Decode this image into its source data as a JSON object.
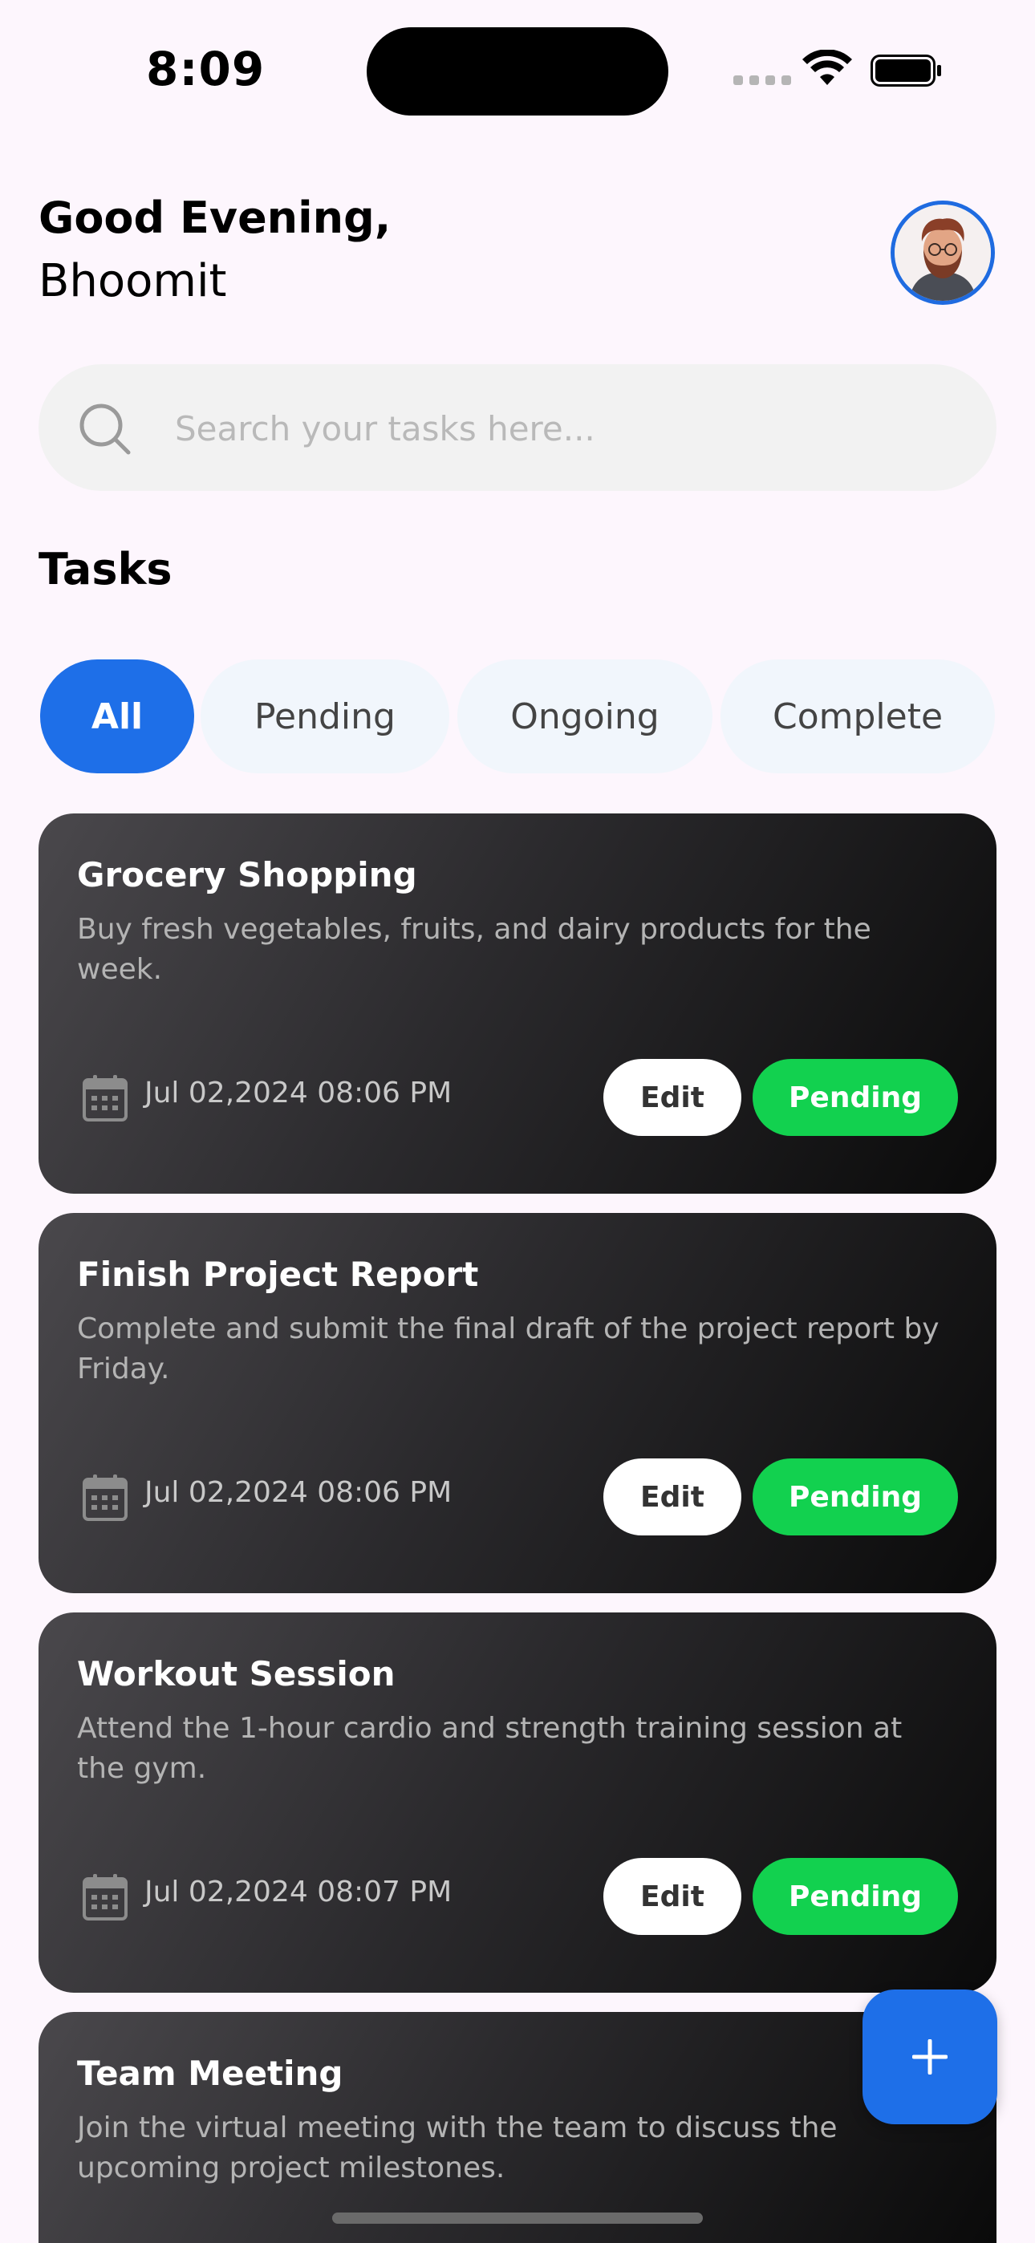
{
  "status_bar": {
    "time": "8:09"
  },
  "header": {
    "greeting": "Good Evening,",
    "user_name": "Bhoomit"
  },
  "search": {
    "placeholder": "Search your tasks here..."
  },
  "tasks_section": {
    "title": "Tasks"
  },
  "filters": [
    {
      "label": "All",
      "active": true
    },
    {
      "label": "Pending",
      "active": false
    },
    {
      "label": "Ongoing",
      "active": false
    },
    {
      "label": "Complete",
      "active": false
    }
  ],
  "tasks": [
    {
      "title": "Grocery Shopping",
      "description": "Buy fresh vegetables, fruits, and dairy products for the week.",
      "date": "Jul 02,2024 08:06 PM",
      "edit_label": "Edit",
      "status": "Pending"
    },
    {
      "title": "Finish Project Report",
      "description": "Complete and submit the final draft of the project report by Friday.",
      "date": "Jul 02,2024 08:06 PM",
      "edit_label": "Edit",
      "status": "Pending"
    },
    {
      "title": "Workout Session",
      "description": "Attend the 1-hour cardio and strength training session at the gym.",
      "date": "Jul 02,2024 08:07 PM",
      "edit_label": "Edit",
      "status": "Pending"
    },
    {
      "title": "Team Meeting",
      "description": "Join the virtual meeting with the team to discuss the upcoming project milestones.",
      "date": "",
      "edit_label": "",
      "status": ""
    }
  ],
  "colors": {
    "accent": "#1e6fe8",
    "status_pending": "#12d14f",
    "card_dark": "#2b2a2d"
  },
  "icons": {
    "search": "search-icon",
    "calendar": "calendar-icon",
    "add": "plus-icon"
  }
}
